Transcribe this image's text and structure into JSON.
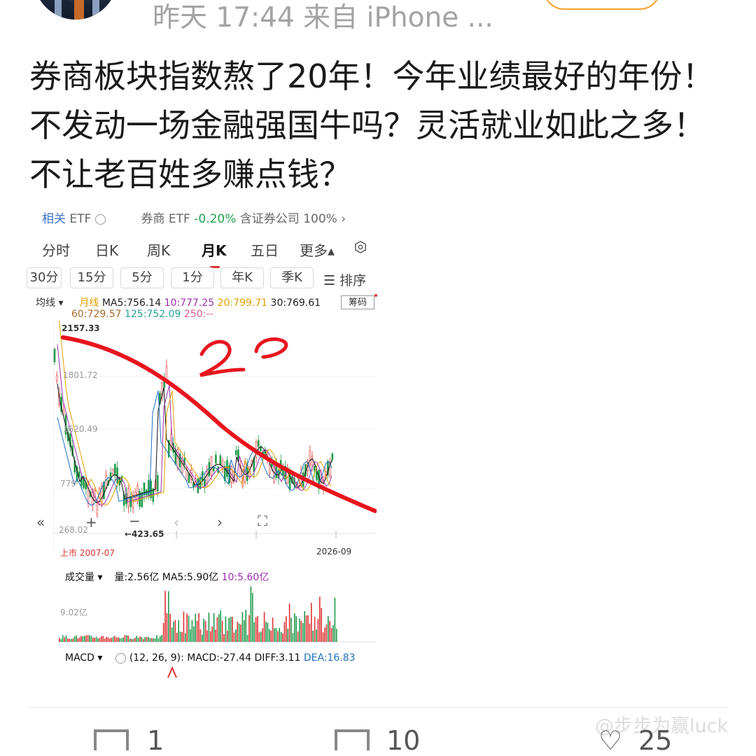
{
  "post": {
    "meta": "昨天 17:44  来自 iPhone ...",
    "text": "券商板块指数熬了20年！今年业绩最好的年份！不发动一场金融强国牛吗？灵活就业如此之多！不让老百姓多赚点钱？"
  },
  "shot": {
    "etf_row": {
      "label_related": "相关",
      "etf": "ETF",
      "etf_name": "券商 ETF",
      "etf_change": "-0.20%",
      "holding": "含证券公司 100%",
      "chevron": "›"
    },
    "tabs": [
      "分时",
      "日K",
      "周K",
      "月K",
      "五日",
      "更多▴"
    ],
    "active_tab": "月K",
    "chips": [
      "30分",
      "15分",
      "5分",
      "1分",
      "年K",
      "季K"
    ],
    "sort_label": "☰ 排序",
    "ma": {
      "mode": "均线 ▾",
      "line": "月线",
      "ma5": "MA5:756.14",
      "ma10": "10:777.25",
      "ma20": "20:799.71",
      "ma30": "30:769.61",
      "ma60": "60:729.57",
      "ma125": "125:752.09",
      "ma250": "250:--",
      "chouma": "筹码"
    },
    "price_labels": {
      "top": "2157.33",
      "y1": "1801.72",
      "y2": "1620.49",
      "y3": "779",
      "y4": "268.02",
      "low": "←423.65",
      "start": "上市 2007-07",
      "end": "2026-09"
    },
    "annotation": "20",
    "volume": {
      "title": "成交量 ▾",
      "amount": "量:2.56亿",
      "ma5": "MA5:5.90亿",
      "ma10": "10:5.60亿",
      "ylabel": "9.02亿"
    },
    "macd": {
      "title": "MACD ▾",
      "params": "(12, 26, 9):",
      "macd": "MACD:-27.44",
      "diff": "DIFF:3.11",
      "dea": "DEA:16.83"
    }
  },
  "actions": {
    "repost_count": "1",
    "comment_count": "10",
    "like_count": "25"
  },
  "watermark": "@步步为赢luck",
  "colors": {
    "up": "#e03232",
    "down": "#1f9a4a",
    "ma5": "#111111",
    "ma10": "#9b2fae",
    "ma20": "#e0a000",
    "ma30": "#1f6fc4",
    "ma60": "#a86a2a",
    "ma125": "#2aa198",
    "ma250": "#e05a8a",
    "annotation": "#e8141e"
  }
}
